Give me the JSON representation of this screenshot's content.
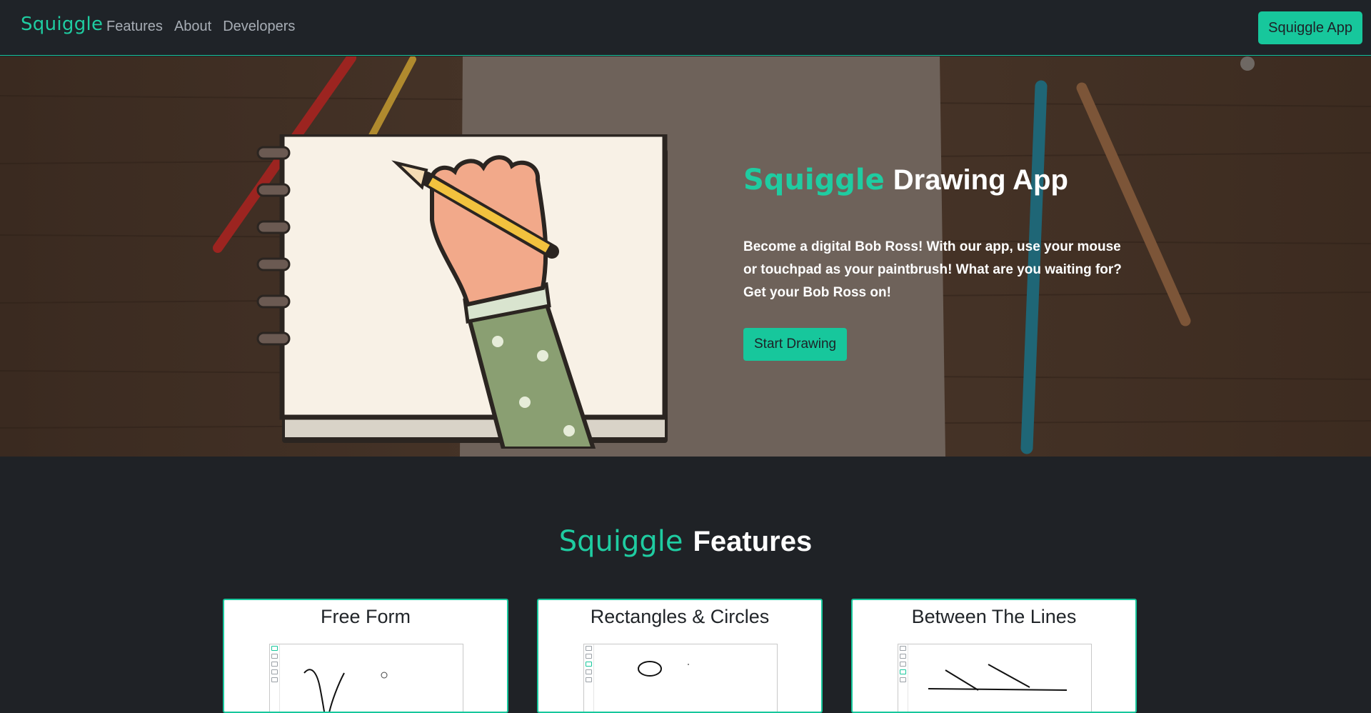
{
  "navbar": {
    "brand": "Squiggle",
    "links": [
      "Features",
      "About",
      "Developers"
    ],
    "app_button": "Squiggle App"
  },
  "hero": {
    "logo": "Squiggle",
    "title": "Drawing App",
    "description": "Become a digital Bob Ross! With our app, use your mouse or touchpad as your paintbrush! What are you waiting for? Get your Bob Ross on!",
    "button": "Start Drawing"
  },
  "features": {
    "logo": "Squiggle",
    "title": "Features",
    "cards": [
      {
        "title": "Free Form"
      },
      {
        "title": "Rectangles & Circles"
      },
      {
        "title": "Between The Lines"
      }
    ]
  },
  "colors": {
    "accent": "#17c79c",
    "background": "#1f2226",
    "navbar": "#1f2328"
  }
}
